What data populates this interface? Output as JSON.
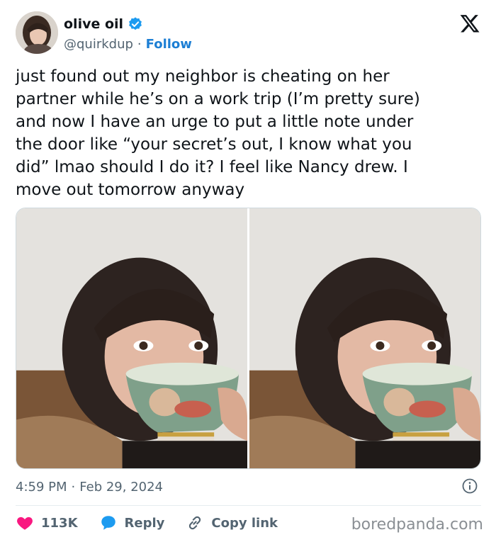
{
  "user": {
    "display_name": "olive oil",
    "handle": "@quirkdup",
    "separator": "·",
    "follow_label": "Follow",
    "verified_color": "#1d9bf0"
  },
  "tweet": {
    "text": "just found out my neighbor is cheating on her\npartner while he’s on a work trip (I’m pretty sure)\nand now I have an urge to put a little note under\nthe door like “your secret’s out, I know what you\ndid” lmao should I do it? I feel like Nancy drew. I\nmove out tomorrow anyway",
    "time": "4:59 PM",
    "date_separator": "·",
    "date": "Feb 29, 2024"
  },
  "media": {
    "photo_count": 2,
    "icons": [
      "photo-left",
      "photo-right"
    ]
  },
  "actions": {
    "likes": "113K",
    "reply_label": "Reply",
    "copy_label": "Copy link",
    "like_color": "#f91880",
    "reply_color": "#1d9bf0",
    "icons": [
      "heart-icon",
      "reply-bubble-icon",
      "link-icon",
      "info-icon",
      "x-logo-icon"
    ]
  },
  "watermark": "boredpanda.com"
}
